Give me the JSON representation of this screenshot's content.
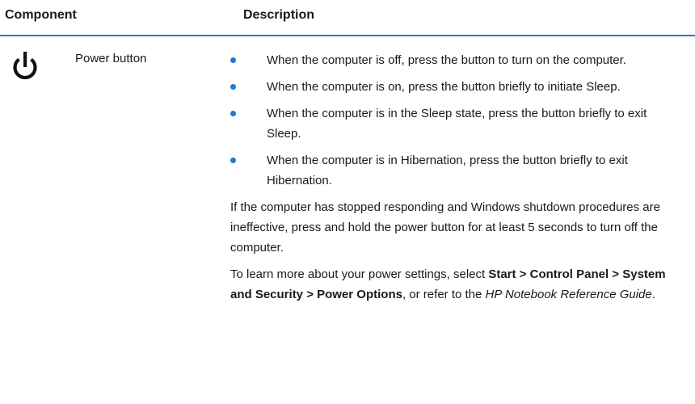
{
  "table": {
    "headers": {
      "component": "Component",
      "description": "Description"
    },
    "accent_color": "#1f78d1",
    "row": {
      "icon": "power-icon",
      "component": "Power button",
      "bullets": [
        "When the computer is off, press the button to turn on the computer.",
        "When the computer is on, press the button briefly to initiate Sleep.",
        "When the computer is in the Sleep state, press the button briefly to exit Sleep.",
        "When the computer is in Hibernation, press the button briefly to exit Hibernation."
      ],
      "paragraph1": "If the computer has stopped responding and Windows shutdown procedures are ineffective, press and hold the power button for at least 5 seconds to turn off the computer.",
      "paragraph2": {
        "prefix": "To learn more about your power settings, select ",
        "bold_path": "Start > Control Panel > System and Security > Power Options",
        "middle": ", or refer to the ",
        "italic_ref": "HP Notebook Reference Guide",
        "suffix": "."
      }
    }
  }
}
